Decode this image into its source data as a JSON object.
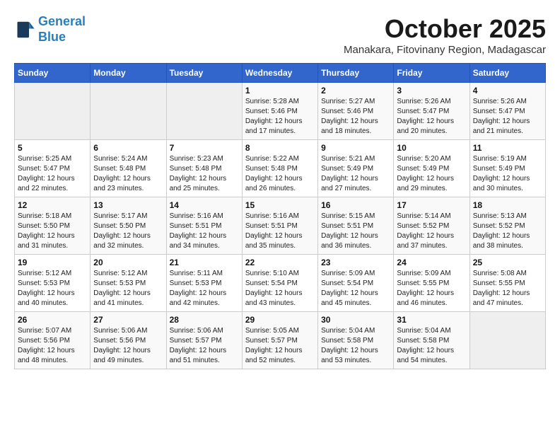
{
  "header": {
    "logo_line1": "General",
    "logo_line2": "Blue",
    "month": "October 2025",
    "location": "Manakara, Fitovinany Region, Madagascar"
  },
  "days_of_week": [
    "Sunday",
    "Monday",
    "Tuesday",
    "Wednesday",
    "Thursday",
    "Friday",
    "Saturday"
  ],
  "weeks": [
    [
      {
        "day": "",
        "info": ""
      },
      {
        "day": "",
        "info": ""
      },
      {
        "day": "",
        "info": ""
      },
      {
        "day": "1",
        "info": "Sunrise: 5:28 AM\nSunset: 5:46 PM\nDaylight: 12 hours\nand 17 minutes."
      },
      {
        "day": "2",
        "info": "Sunrise: 5:27 AM\nSunset: 5:46 PM\nDaylight: 12 hours\nand 18 minutes."
      },
      {
        "day": "3",
        "info": "Sunrise: 5:26 AM\nSunset: 5:47 PM\nDaylight: 12 hours\nand 20 minutes."
      },
      {
        "day": "4",
        "info": "Sunrise: 5:26 AM\nSunset: 5:47 PM\nDaylight: 12 hours\nand 21 minutes."
      }
    ],
    [
      {
        "day": "5",
        "info": "Sunrise: 5:25 AM\nSunset: 5:47 PM\nDaylight: 12 hours\nand 22 minutes."
      },
      {
        "day": "6",
        "info": "Sunrise: 5:24 AM\nSunset: 5:48 PM\nDaylight: 12 hours\nand 23 minutes."
      },
      {
        "day": "7",
        "info": "Sunrise: 5:23 AM\nSunset: 5:48 PM\nDaylight: 12 hours\nand 25 minutes."
      },
      {
        "day": "8",
        "info": "Sunrise: 5:22 AM\nSunset: 5:48 PM\nDaylight: 12 hours\nand 26 minutes."
      },
      {
        "day": "9",
        "info": "Sunrise: 5:21 AM\nSunset: 5:49 PM\nDaylight: 12 hours\nand 27 minutes."
      },
      {
        "day": "10",
        "info": "Sunrise: 5:20 AM\nSunset: 5:49 PM\nDaylight: 12 hours\nand 29 minutes."
      },
      {
        "day": "11",
        "info": "Sunrise: 5:19 AM\nSunset: 5:49 PM\nDaylight: 12 hours\nand 30 minutes."
      }
    ],
    [
      {
        "day": "12",
        "info": "Sunrise: 5:18 AM\nSunset: 5:50 PM\nDaylight: 12 hours\nand 31 minutes."
      },
      {
        "day": "13",
        "info": "Sunrise: 5:17 AM\nSunset: 5:50 PM\nDaylight: 12 hours\nand 32 minutes."
      },
      {
        "day": "14",
        "info": "Sunrise: 5:16 AM\nSunset: 5:51 PM\nDaylight: 12 hours\nand 34 minutes."
      },
      {
        "day": "15",
        "info": "Sunrise: 5:16 AM\nSunset: 5:51 PM\nDaylight: 12 hours\nand 35 minutes."
      },
      {
        "day": "16",
        "info": "Sunrise: 5:15 AM\nSunset: 5:51 PM\nDaylight: 12 hours\nand 36 minutes."
      },
      {
        "day": "17",
        "info": "Sunrise: 5:14 AM\nSunset: 5:52 PM\nDaylight: 12 hours\nand 37 minutes."
      },
      {
        "day": "18",
        "info": "Sunrise: 5:13 AM\nSunset: 5:52 PM\nDaylight: 12 hours\nand 38 minutes."
      }
    ],
    [
      {
        "day": "19",
        "info": "Sunrise: 5:12 AM\nSunset: 5:53 PM\nDaylight: 12 hours\nand 40 minutes."
      },
      {
        "day": "20",
        "info": "Sunrise: 5:12 AM\nSunset: 5:53 PM\nDaylight: 12 hours\nand 41 minutes."
      },
      {
        "day": "21",
        "info": "Sunrise: 5:11 AM\nSunset: 5:53 PM\nDaylight: 12 hours\nand 42 minutes."
      },
      {
        "day": "22",
        "info": "Sunrise: 5:10 AM\nSunset: 5:54 PM\nDaylight: 12 hours\nand 43 minutes."
      },
      {
        "day": "23",
        "info": "Sunrise: 5:09 AM\nSunset: 5:54 PM\nDaylight: 12 hours\nand 45 minutes."
      },
      {
        "day": "24",
        "info": "Sunrise: 5:09 AM\nSunset: 5:55 PM\nDaylight: 12 hours\nand 46 minutes."
      },
      {
        "day": "25",
        "info": "Sunrise: 5:08 AM\nSunset: 5:55 PM\nDaylight: 12 hours\nand 47 minutes."
      }
    ],
    [
      {
        "day": "26",
        "info": "Sunrise: 5:07 AM\nSunset: 5:56 PM\nDaylight: 12 hours\nand 48 minutes."
      },
      {
        "day": "27",
        "info": "Sunrise: 5:06 AM\nSunset: 5:56 PM\nDaylight: 12 hours\nand 49 minutes."
      },
      {
        "day": "28",
        "info": "Sunrise: 5:06 AM\nSunset: 5:57 PM\nDaylight: 12 hours\nand 51 minutes."
      },
      {
        "day": "29",
        "info": "Sunrise: 5:05 AM\nSunset: 5:57 PM\nDaylight: 12 hours\nand 52 minutes."
      },
      {
        "day": "30",
        "info": "Sunrise: 5:04 AM\nSunset: 5:58 PM\nDaylight: 12 hours\nand 53 minutes."
      },
      {
        "day": "31",
        "info": "Sunrise: 5:04 AM\nSunset: 5:58 PM\nDaylight: 12 hours\nand 54 minutes."
      },
      {
        "day": "",
        "info": ""
      }
    ]
  ]
}
